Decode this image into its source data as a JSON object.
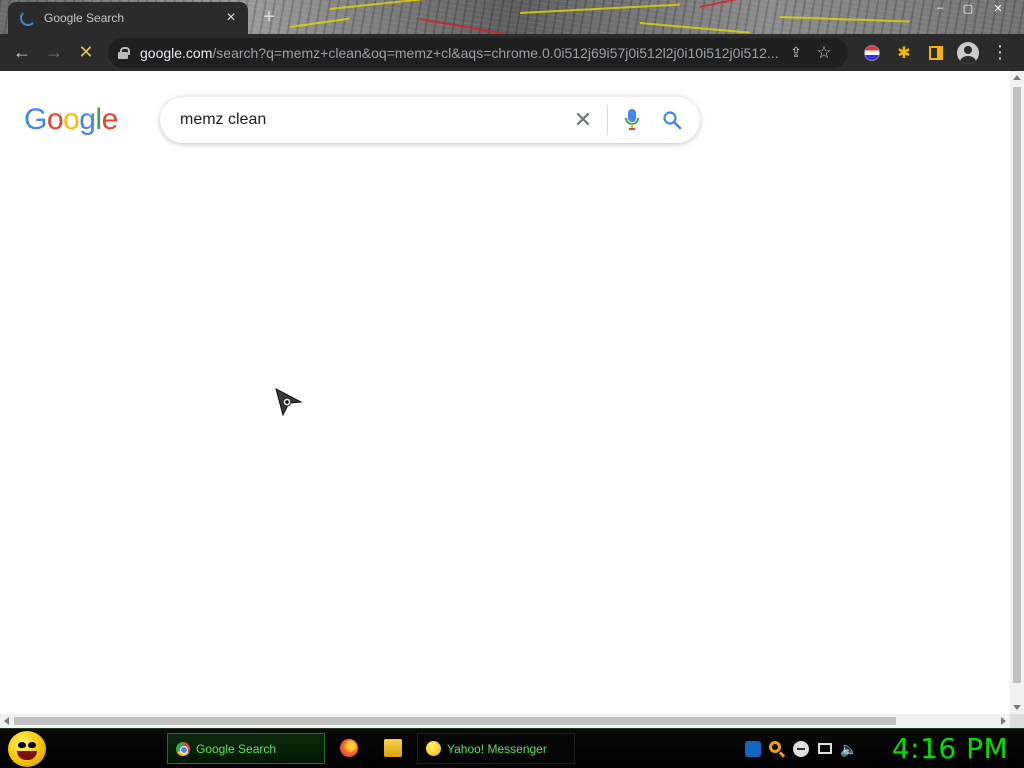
{
  "browser": {
    "tab": {
      "title": "Google Search",
      "close_glyph": "×"
    },
    "new_tab_glyph": "+",
    "window_controls": [
      "–",
      "▢",
      "✕"
    ],
    "toolbar": {
      "back_glyph": "←",
      "forward_glyph": "→",
      "stop_glyph": "✕",
      "url_host": "google.com",
      "url_path": "/search?q=memz+clean&oq=memz+cl&aqs=chrome.0.0i512j69i57j0i512l2j0i10i512j0i512...",
      "share_glyph": "⇪",
      "bookmark_glyph": "☆",
      "puzzle_glyph": "✱",
      "menu_glyph": "⋮"
    }
  },
  "page": {
    "logo_letters": [
      "G",
      "o",
      "o",
      "g",
      "l",
      "e"
    ],
    "search": {
      "value": "memz clean",
      "clear_glyph": "✕"
    }
  },
  "taskbar": {
    "tasks": [
      {
        "label": "Google Search"
      },
      {
        "label": "Yahoo! Messenger"
      }
    ],
    "speaker_glyph": "🔈",
    "clock": "4:16 PM"
  },
  "colors": {
    "chrome_dark": "#2b2b2b",
    "taskbar_text": "#5fe05f",
    "clock": "#00e000",
    "google_blue": "#4285f4",
    "google_red": "#ea4335",
    "google_yellow": "#fbbc05",
    "google_green": "#34a853"
  }
}
